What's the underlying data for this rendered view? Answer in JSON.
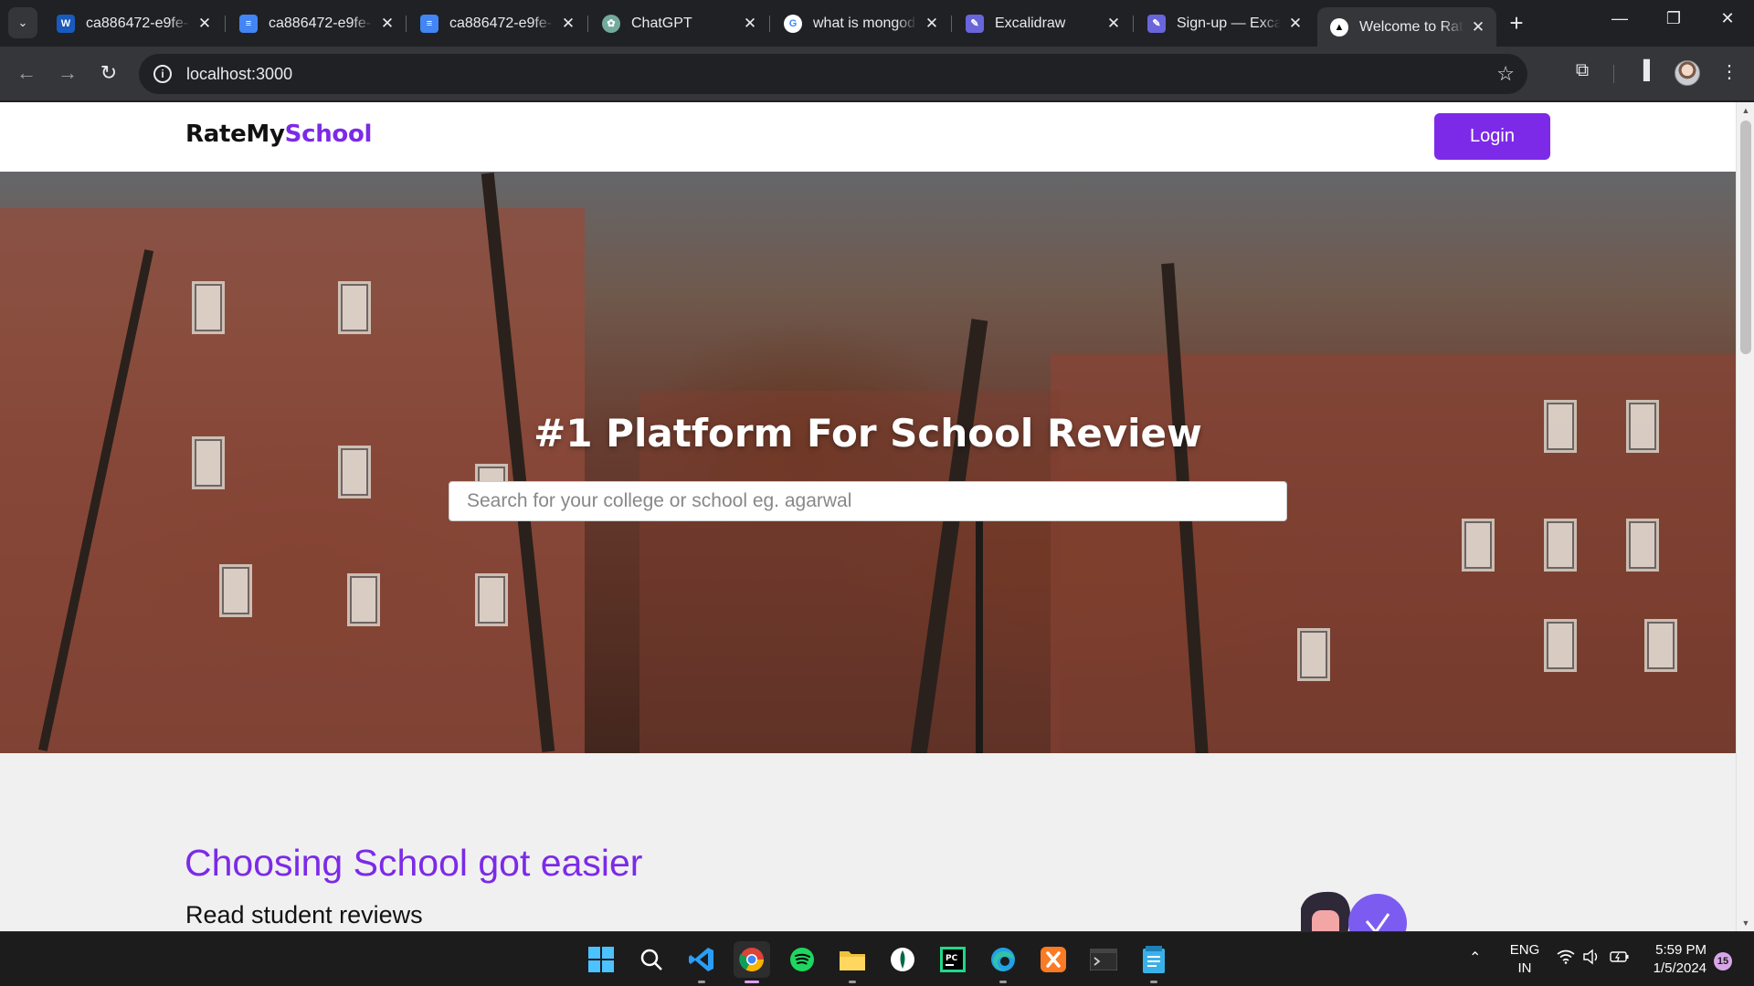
{
  "browser": {
    "tabs": [
      {
        "title": "ca886472-e9fe-",
        "icon": "word-icon",
        "color": "#185abd"
      },
      {
        "title": "ca886472-e9fe-",
        "icon": "docs-icon",
        "color": "#4285f4"
      },
      {
        "title": "ca886472-e9fe-",
        "icon": "docs-icon",
        "color": "#4285f4"
      },
      {
        "title": "ChatGPT",
        "icon": "chatgpt-icon",
        "color": "#74aa9c"
      },
      {
        "title": "what is mongod",
        "icon": "google-icon",
        "color": "#ffffff"
      },
      {
        "title": "Excalidraw",
        "icon": "excalidraw-icon",
        "color": "#6965db"
      },
      {
        "title": "Sign-up — Exca",
        "icon": "excalidraw-icon",
        "color": "#6965db"
      },
      {
        "title": "Welcome to Rat",
        "icon": "vercel-icon",
        "color": "#000000"
      }
    ],
    "url": "localhost:3000"
  },
  "site": {
    "logo_part1": "RateMy",
    "logo_part2": "School",
    "login_label": "Login",
    "accent_color": "#7c2ae8",
    "hero_title": "#1 Platform For School Review",
    "search_placeholder": "Search for your college or school eg. agarwal",
    "section_heading": "Choosing School got easier",
    "section_subheading": "Read student reviews"
  },
  "taskbar": {
    "apps": [
      "windows-start-icon",
      "search-icon",
      "vscode-icon",
      "chrome-icon",
      "spotify-icon",
      "file-explorer-icon",
      "mongodb-compass-icon",
      "pycharm-icon",
      "edge-icon",
      "xampp-icon",
      "terminal-icon",
      "notepad-icon"
    ],
    "language": "ENG",
    "region": "IN",
    "time": "5:59 PM",
    "date": "1/5/2024",
    "notification_count": "15"
  }
}
